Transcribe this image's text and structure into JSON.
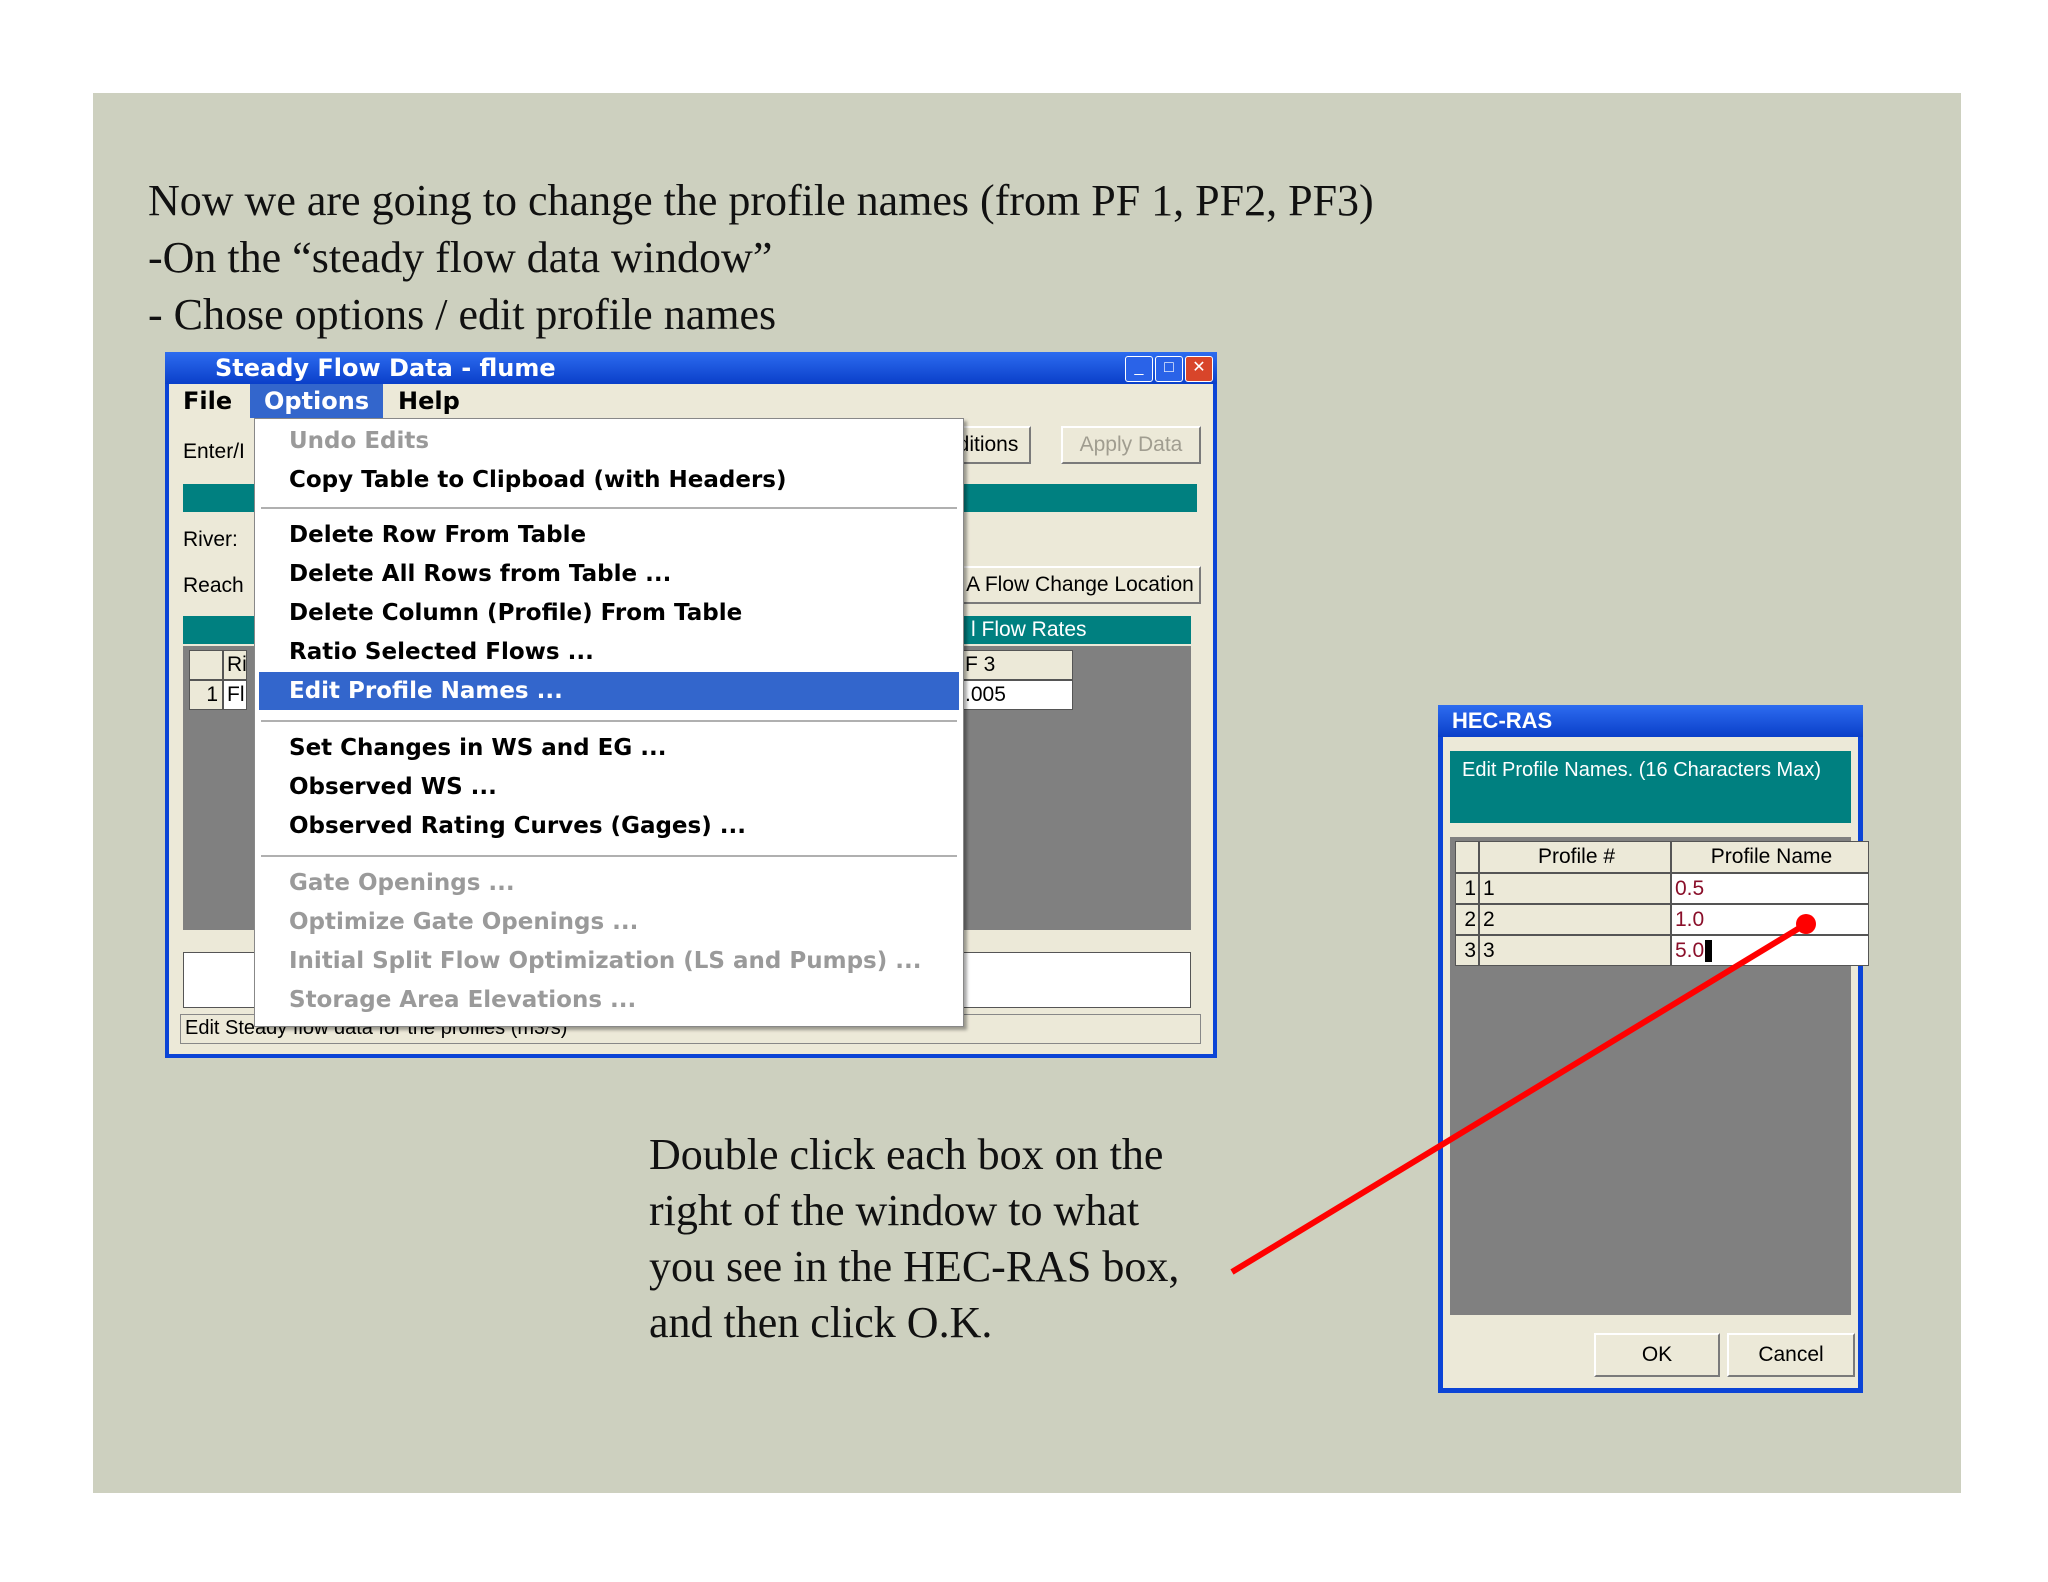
{
  "intro": {
    "line1": "Now we are going to change the profile names (from PF 1, PF2, PF3)",
    "line2": "-On the “steady flow data window”",
    "line3": "- Chose options / edit profile names"
  },
  "note": {
    "line1": "Double click each box on the",
    "line2": "right of the window to what",
    "line3": "you see in the HEC-RAS box,",
    "line4": "and then click O.K."
  },
  "steady_window": {
    "title": "Steady Flow Data - flume",
    "menus": {
      "file": "File",
      "options": "Options",
      "help": "Help"
    },
    "enter_label": "Enter/I",
    "river_label": "River:",
    "reach_label": "Reach",
    "conditions_btn": "ditions",
    "apply_btn": "Apply Data",
    "flow_change_btn": "A Flow Change Location",
    "flow_rates_header": "l Flow Rates",
    "table_row_hdr": "Ri",
    "table_row1_num": "1",
    "table_row1_cell": "Fl",
    "pf3_header": "F 3",
    "pf3_value": ".005",
    "status": "Edit Steady flow data for the profiles (m3/s)"
  },
  "options_menu": {
    "undo": "Undo Edits",
    "copy": "Copy Table to Clipboad (with Headers)",
    "delete_row": "Delete Row From Table",
    "delete_all": "Delete All Rows from Table ...",
    "delete_col": "Delete Column (Profile) From Table",
    "ratio": "Ratio Selected Flows ...",
    "edit_names": "Edit Profile Names ...",
    "set_changes": "Set Changes in WS and EG ...",
    "observed_ws": "Observed WS ...",
    "observed_rating": "Observed Rating Curves (Gages) ...",
    "gate_openings": "Gate Openings ...",
    "optimize_gate": "Optimize Gate Openings ...",
    "initial_split": "Initial Split Flow Optimization (LS and Pumps) ...",
    "storage_area": "Storage Area Elevations ..."
  },
  "hecras_dialog": {
    "title": "HEC-RAS",
    "caption": "Edit Profile Names. (16 Characters Max)",
    "col_profile_num": "Profile #",
    "col_profile_name": "Profile Name",
    "rows": [
      {
        "idx": "1",
        "num": "1",
        "name": "0.5"
      },
      {
        "idx": "2",
        "num": "2",
        "name": "1.0"
      },
      {
        "idx": "3",
        "num": "3",
        "name": "5.0"
      }
    ],
    "ok": "OK",
    "cancel": "Cancel"
  },
  "colors": {
    "slide_bg": "#cdd0bf",
    "title_blue": "#0b44d6",
    "teal": "#008080",
    "highlight": "#3366cc",
    "arrow": "#ff0000"
  }
}
